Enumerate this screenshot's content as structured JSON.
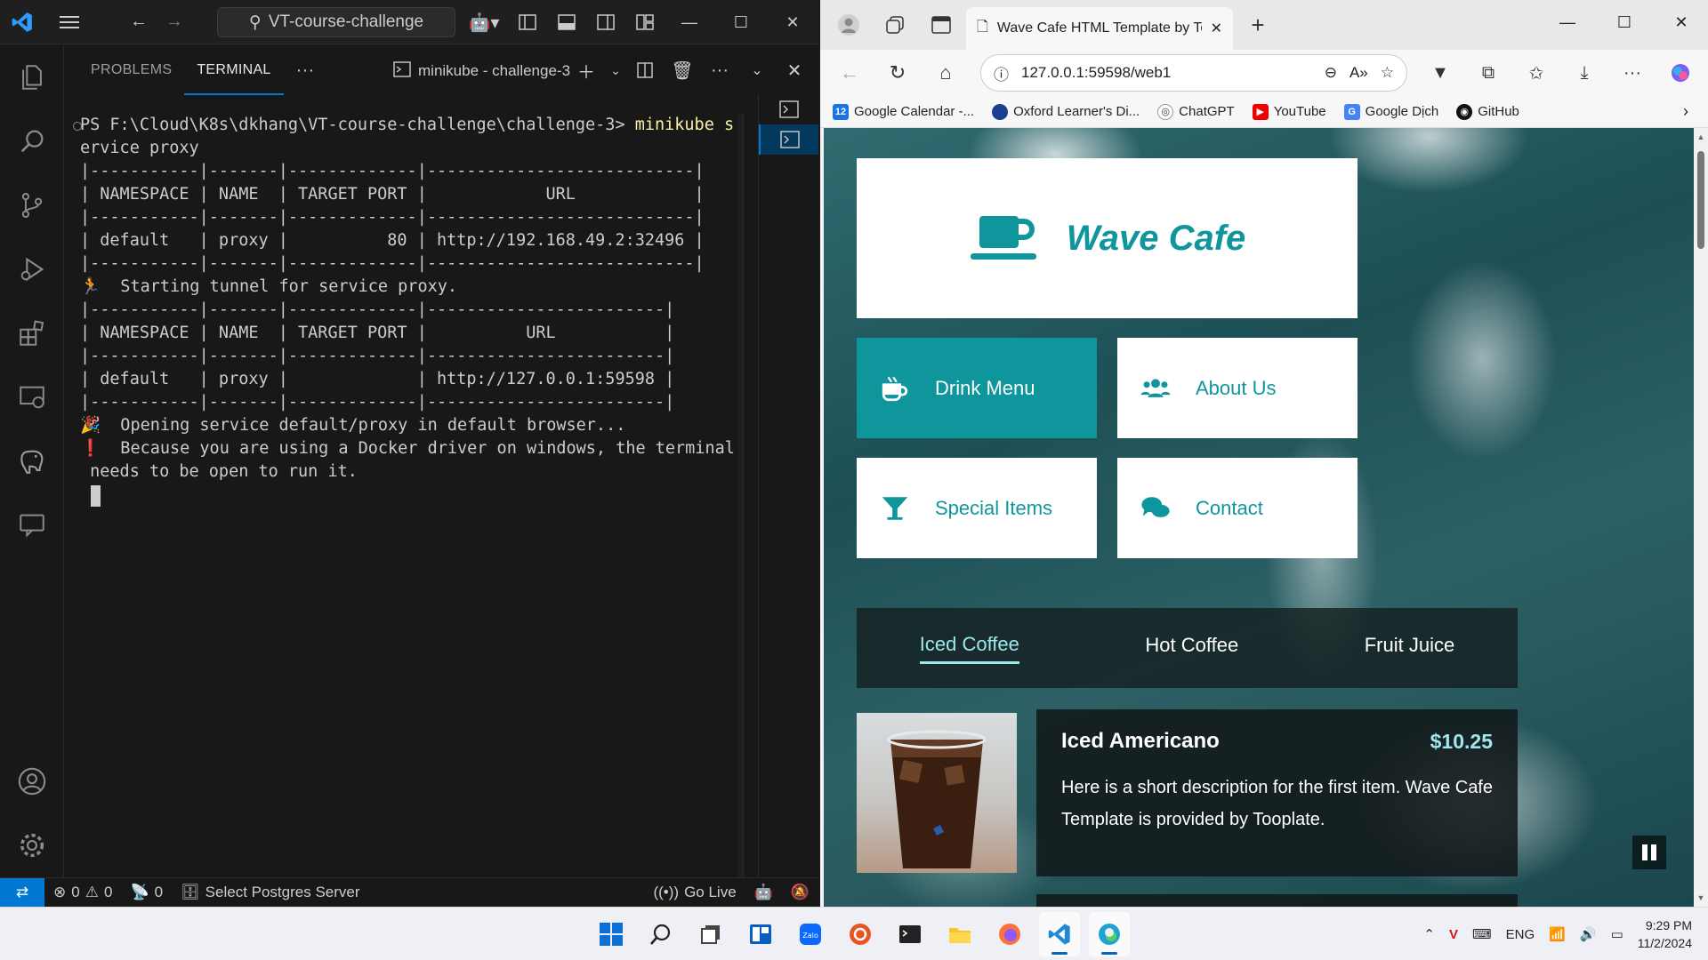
{
  "vscode": {
    "search_text": "VT-course-challenge",
    "panel_tabs": [
      "PROBLEMS",
      "TERMINAL"
    ],
    "more_label": "···",
    "terminal_name": "minikube - challenge-3",
    "terminal_lines": [
      {
        "text": "PS F:\\Cloud\\K8s\\dkhang\\VT-course-challenge\\challenge-3> ",
        "cmd": "minikube s"
      },
      {
        "text": "ervice proxy"
      },
      {
        "text": "|-----------|-------|-------------|---------------------------|"
      },
      {
        "text": "| NAMESPACE | NAME  | TARGET PORT |            URL            |"
      },
      {
        "text": "|-----------|-------|-------------|---------------------------|"
      },
      {
        "text": "| default   | proxy |          80 | http://192.168.49.2:32496 |"
      },
      {
        "text": "|-----------|-------|-------------|---------------------------|"
      },
      {
        "text": "🏃  Starting tunnel for service proxy."
      },
      {
        "text": "|-----------|-------|-------------|------------------------|"
      },
      {
        "text": "| NAMESPACE | NAME  | TARGET PORT |          URL           |"
      },
      {
        "text": "|-----------|-------|-------------|------------------------|"
      },
      {
        "text": "| default   | proxy |             | http://127.0.0.1:59598 |"
      },
      {
        "text": "|-----------|-------|-------------|------------------------|"
      },
      {
        "text": "🎉  Opening service default/proxy in default browser..."
      },
      {
        "text": "❗  Because you are using a Docker driver on windows, the terminal"
      },
      {
        "text": " needs to be open to run it."
      }
    ],
    "status": {
      "errors": "0",
      "warnings": "0",
      "ports": "0",
      "postgres": "Select Postgres Server",
      "golive": "Go Live"
    }
  },
  "edge": {
    "tab_title": "Wave Cafe HTML Template by Tooplate",
    "url": "127.0.0.1:59598/web1",
    "bookmarks": [
      "Google Calendar -...",
      "Oxford Learner's Di...",
      "ChatGPT",
      "YouTube",
      "Google Dịch",
      "GitHub"
    ]
  },
  "wavecafe": {
    "brand": "Wave Cafe",
    "menu": [
      "Drink Menu",
      "About Us",
      "Special Items",
      "Contact"
    ],
    "tabs": [
      "Iced Coffee",
      "Hot Coffee",
      "Fruit Juice"
    ],
    "item": {
      "name": "Iced Americano",
      "price": "$10.25",
      "description": "Here is a short description for the first item. Wave Cafe Template is provided by Tooplate."
    }
  },
  "taskbar": {
    "lang": "ENG",
    "time": "9:29 PM",
    "date": "11/2/2024"
  },
  "colors": {
    "teal": "#0f969c",
    "vscode_blue": "#0078d4"
  }
}
